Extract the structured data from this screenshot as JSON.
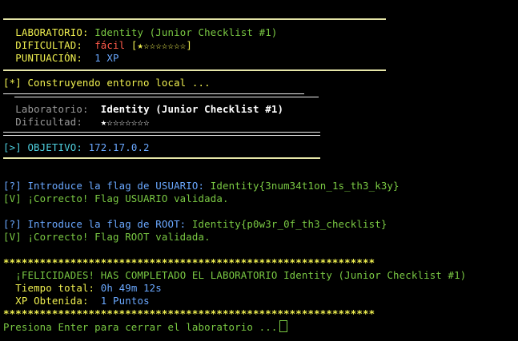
{
  "colors": {
    "background": "#000000",
    "rule": "#e6e6a8",
    "yellow": "#f0f050",
    "green": "#7ac943",
    "cyan": "#4fd0e0",
    "blue": "#6aa8ff",
    "red": "#ff5a4a"
  },
  "header": {
    "lab_label": "LABORATORIO:",
    "lab_value": "Identity (Junior Checklist #1)",
    "diff_label": "DIFICULTAD:",
    "diff_value": "fácil",
    "diff_stars": "[★☆☆☆☆☆☆☆]",
    "score_label": "PUNTUACIÓN:",
    "score_value": "1 XP"
  },
  "build": {
    "message": "[*] Construyendo entorno local ..."
  },
  "box": {
    "lab_label": "Laboratorio:",
    "lab_value": "Identity (Junior Checklist #1)",
    "diff_label": "Dificultad:",
    "diff_stars": "★☆☆☆☆☆☆☆"
  },
  "objective": {
    "prefix": "[>] OBJETIVO:",
    "ip": "172.17.0.2"
  },
  "user_flag": {
    "prompt": "[?] Introduce la flag de USUARIO:",
    "value": "Identity{3num34t1on_1s_th3_k3y}",
    "result": "[V] ¡Correcto! Flag USUARIO validada."
  },
  "root_flag": {
    "prompt": "[?] Introduce la flag de ROOT:",
    "value": "Identity{p0w3r_0f_th3_checklist}",
    "result": "[V] ¡Correcto! Flag ROOT validada."
  },
  "finish": {
    "stars_line": "*************************************************************",
    "congrats": "¡FELICIDADES! HAS COMPLETADO EL LABORATORIO Identity (Junior Checklist #1)",
    "time_label": "Tiempo total:",
    "time_value": "0h 49m 12s",
    "xp_label": "XP Obtenida:",
    "xp_value": "1 Puntos",
    "exit_prompt": "Presiona Enter para cerrar el laboratorio ..."
  }
}
